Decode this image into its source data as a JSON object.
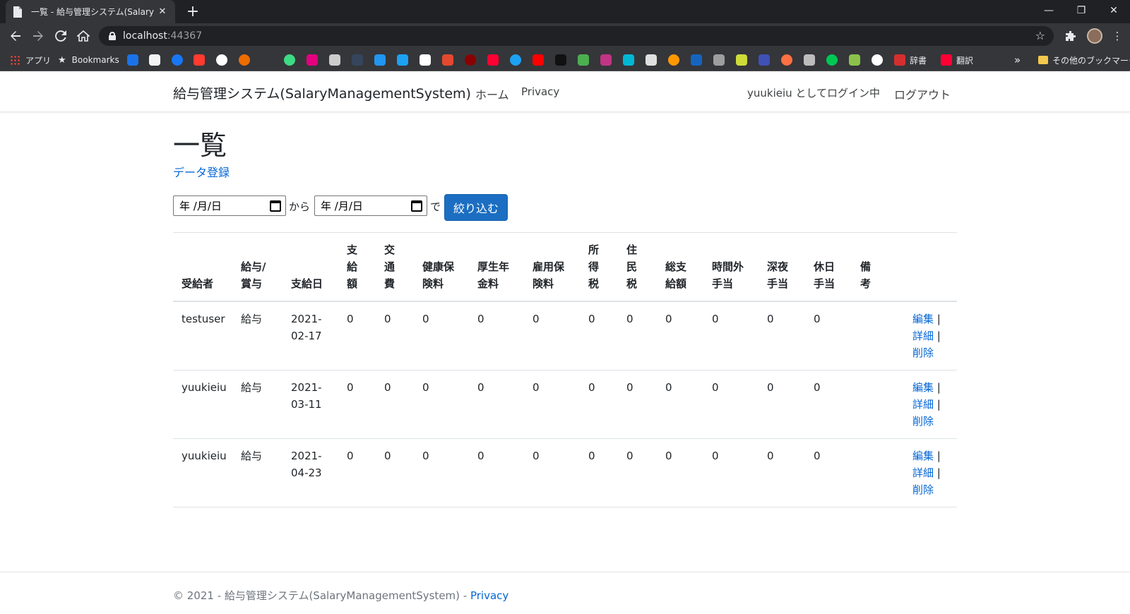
{
  "browser": {
    "tab_title": "一覧 - 給与管理システム(SalaryMa",
    "tab_close": "✕",
    "new_tab": "+",
    "window": {
      "minimize": "—",
      "restore": "❐",
      "close": "✕"
    },
    "url_host": "localhost",
    "url_port": ":44367",
    "bookmarks": {
      "apps_label": "アプリ",
      "bookmarks_label": "Bookmarks",
      "jisho_label": "辞書",
      "honyaku_label": "翻訳",
      "other_label": "その他のブックマーク",
      "overflow": "»"
    }
  },
  "site": {
    "brand": "給与管理システム(SalaryManagementSystem)",
    "nav": {
      "home": "ホーム",
      "privacy": "Privacy"
    },
    "user": {
      "login_status": "yuukieiu としてログイン中",
      "logout": "ログアウト"
    }
  },
  "main": {
    "title": "一覧",
    "create_link": "データ登録",
    "filter": {
      "from_value": "年 /月/日",
      "from_label": "から",
      "to_value": "年 /月/日",
      "to_label": "で",
      "button": "絞り込む"
    },
    "table": {
      "headers": [
        "受給者",
        "給与/賞与",
        "支給日",
        "支給額",
        "交通費",
        "健康保険料",
        "厚生年金料",
        "雇用保険料",
        "所得税",
        "住民税",
        "総支給額",
        "時間外手当",
        "深夜手当",
        "休日手当",
        "備考",
        ""
      ],
      "rows": [
        {
          "recipient": "testuser",
          "type": "給与",
          "date": "2021-02-17",
          "amount": "0",
          "transport": "0",
          "health": "0",
          "pension": "0",
          "employment": "0",
          "income_tax": "0",
          "resident_tax": "0",
          "total": "0",
          "overtime": "0",
          "night": "0",
          "holiday": "0",
          "note": ""
        },
        {
          "recipient": "yuukieiu",
          "type": "給与",
          "date": "2021-03-11",
          "amount": "0",
          "transport": "0",
          "health": "0",
          "pension": "0",
          "employment": "0",
          "income_tax": "0",
          "resident_tax": "0",
          "total": "0",
          "overtime": "0",
          "night": "0",
          "holiday": "0",
          "note": ""
        },
        {
          "recipient": "yuukieiu",
          "type": "給与",
          "date": "2021-04-23",
          "amount": "0",
          "transport": "0",
          "health": "0",
          "pension": "0",
          "employment": "0",
          "income_tax": "0",
          "resident_tax": "0",
          "total": "0",
          "overtime": "0",
          "night": "0",
          "holiday": "0",
          "note": ""
        }
      ],
      "actions": {
        "edit": "編集",
        "details": "詳細",
        "delete": "削除",
        "separator": "|"
      }
    }
  },
  "footer": {
    "copyright": "© 2021 - 給与管理システム(SalaryManagementSystem) - ",
    "privacy": "Privacy"
  },
  "colors": {
    "link": "#0366d6",
    "primary_button": "#1b6ec2",
    "chrome_dark": "#202124",
    "chrome_toolbar": "#35363a"
  }
}
